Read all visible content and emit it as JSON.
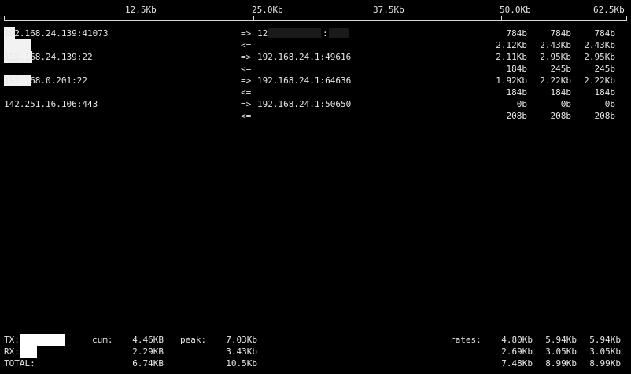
{
  "scale": {
    "labels": [
      "12.5Kb",
      "25.0Kb",
      "37.5Kb",
      "50.0Kb",
      "62.5Kb"
    ]
  },
  "connections": [
    {
      "host": "192.168.24.139:41073",
      "remote": "12",
      "remote_suffix": ":",
      "out_arrow": "=>",
      "in_arrow": "<=",
      "out_rates": [
        "784b",
        "784b",
        "784b"
      ],
      "in_rates": [
        "2.12Kb",
        "2.43Kb",
        "2.43Kb"
      ]
    },
    {
      "host": "192.168.24.139:22",
      "remote": "192.168.24.1:49616",
      "out_arrow": "=>",
      "in_arrow": "<=",
      "out_rates": [
        "2.11Kb",
        "2.95Kb",
        "2.95Kb"
      ],
      "in_rates": [
        "184b",
        "245b",
        "245b"
      ]
    },
    {
      "host": "192.168.0.201:22",
      "remote": "192.168.24.1:64636",
      "out_arrow": "=>",
      "in_arrow": "<=",
      "out_rates": [
        "1.92Kb",
        "2.22Kb",
        "2.22Kb"
      ],
      "in_rates": [
        "184b",
        "184b",
        "184b"
      ]
    },
    {
      "host": "142.251.16.106:443",
      "remote": "192.168.24.1:50650",
      "out_arrow": "=>",
      "in_arrow": "<=",
      "out_rates": [
        "0b",
        "0b",
        "0b"
      ],
      "in_rates": [
        "208b",
        "208b",
        "208b"
      ]
    }
  ],
  "totals": {
    "cum_label": "cum:",
    "peak_label": "peak:",
    "rates_label": "rates:",
    "rows": [
      {
        "label": "TX:",
        "cum": "4.46KB",
        "peak": "7.03Kb",
        "rates": [
          "4.80Kb",
          "5.94Kb",
          "5.94Kb"
        ]
      },
      {
        "label": "RX:",
        "cum": "2.29KB",
        "peak": "3.43Kb",
        "rates": [
          "2.69Kb",
          "3.05Kb",
          "3.05Kb"
        ]
      },
      {
        "label": "TOTAL:",
        "cum": "6.74KB",
        "peak": "10.5Kb",
        "rates": [
          "7.48Kb",
          "8.99Kb",
          "8.99Kb"
        ]
      }
    ]
  },
  "colors": {
    "background": "#000000",
    "text": "#e6e6e6",
    "bar": "#f2f2f2"
  }
}
